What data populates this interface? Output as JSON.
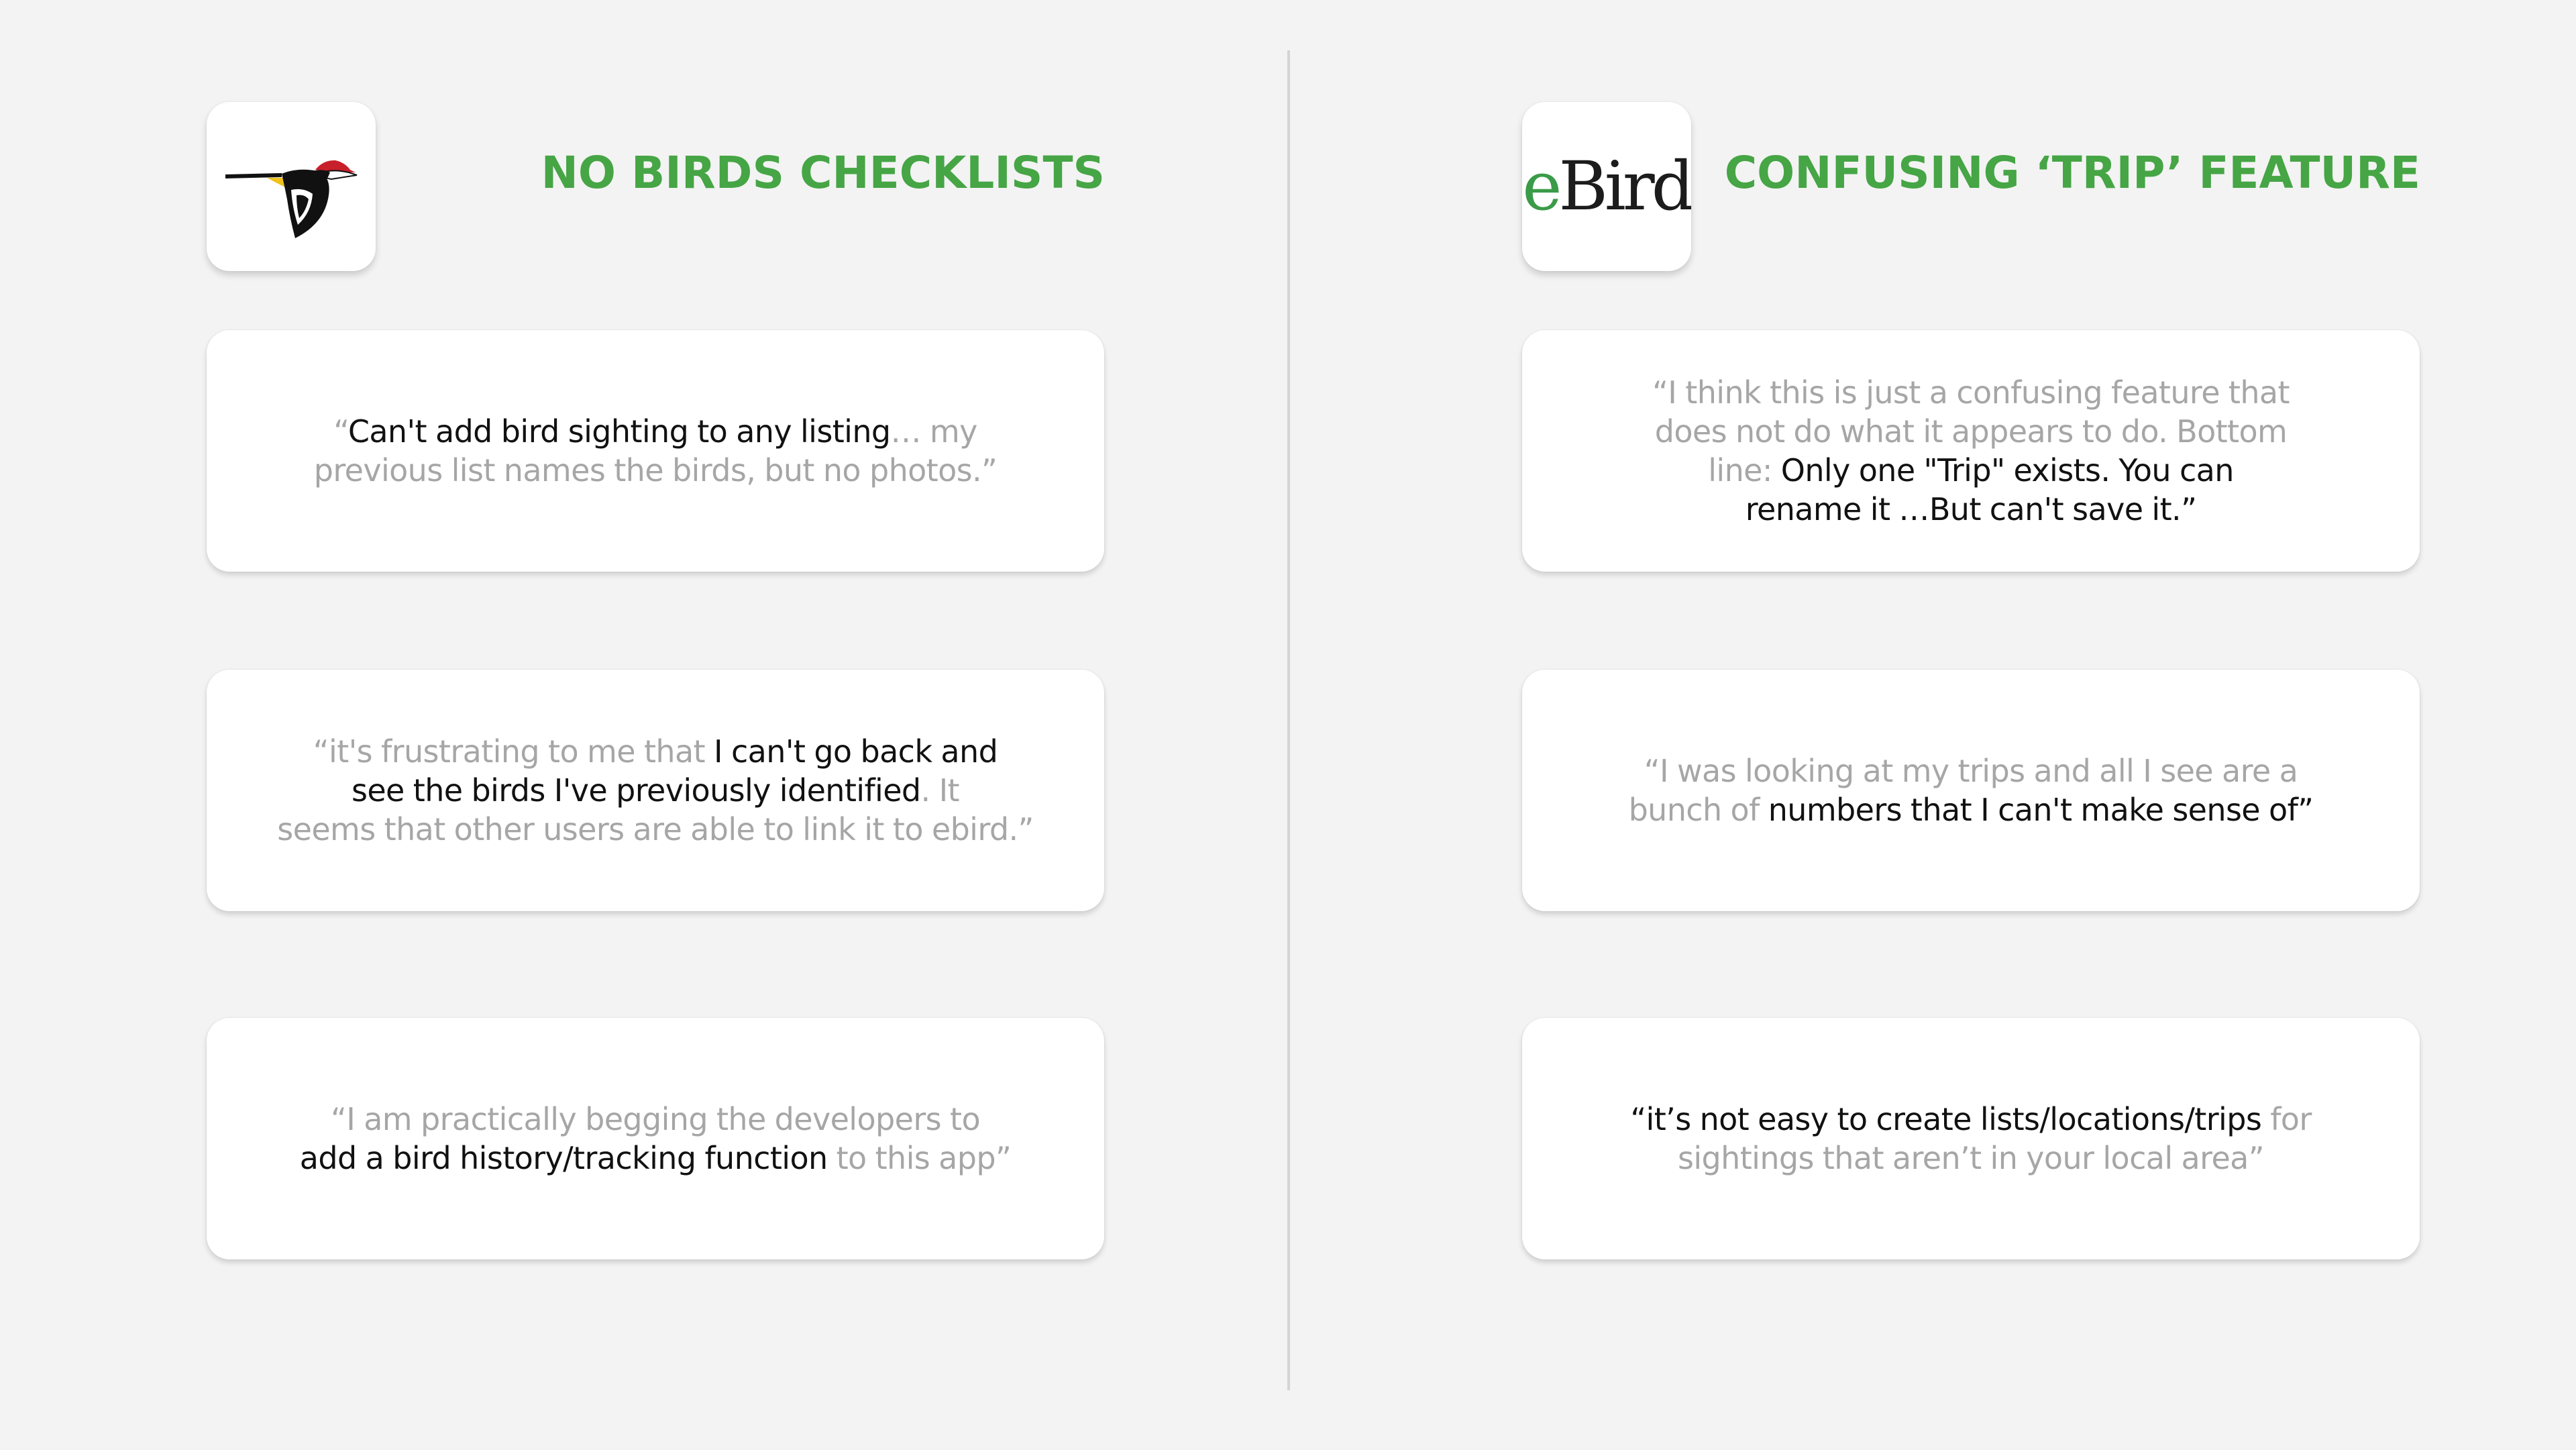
{
  "left": {
    "title": "NO BIRDS CHECKLISTS",
    "icon": "merlin-bird-id-icon",
    "quotes": [
      {
        "parts": [
          {
            "text": "“",
            "highlight": false
          },
          {
            "text": "Can't add bird sighting to any listing",
            "highlight": true
          },
          {
            "text": "… my ",
            "highlight": false
          },
          {
            "text": "\n",
            "highlight": false
          },
          {
            "text": "previous list names the birds, but no photos.”",
            "highlight": false
          }
        ]
      },
      {
        "parts": [
          {
            "text": "“it's frustrating to me that ",
            "highlight": false
          },
          {
            "text": "I can't go back and",
            "highlight": true
          },
          {
            "text": "\n",
            "highlight": false
          },
          {
            "text": "see the birds I've previously identified",
            "highlight": true
          },
          {
            "text": ". It",
            "highlight": false
          },
          {
            "text": "\n",
            "highlight": false
          },
          {
            "text": "seems that other users are able to link it to ebird.”",
            "highlight": false
          }
        ]
      },
      {
        "parts": [
          {
            "text": "“I am practically begging the developers to",
            "highlight": false
          },
          {
            "text": "\n",
            "highlight": false
          },
          {
            "text": "add a bird history/tracking function",
            "highlight": true
          },
          {
            "text": " to this app”",
            "highlight": false
          }
        ]
      }
    ]
  },
  "right": {
    "title": "CONFUSING ‘TRIP’ FEATURE",
    "icon": "ebird-icon",
    "logo_text_e": "e",
    "logo_text_rest": "Bird",
    "quotes": [
      {
        "parts": [
          {
            "text": "“I think this is just a confusing feature that",
            "highlight": false
          },
          {
            "text": "\n",
            "highlight": false
          },
          {
            "text": "does not do what it appears to do. Bottom",
            "highlight": false
          },
          {
            "text": "\n",
            "highlight": false
          },
          {
            "text": "line: ",
            "highlight": false
          },
          {
            "text": "Only one \"Trip\" exists. You can",
            "highlight": true
          },
          {
            "text": "\n",
            "highlight": false
          },
          {
            "text": "rename it …But can't save it.”",
            "highlight": true
          }
        ]
      },
      {
        "parts": [
          {
            "text": "“I was looking at my trips and all I see are a",
            "highlight": false
          },
          {
            "text": "\n",
            "highlight": false
          },
          {
            "text": "bunch of ",
            "highlight": false
          },
          {
            "text": "numbers that I can't make sense of”",
            "highlight": true
          }
        ]
      },
      {
        "parts": [
          {
            "text": "“it’s not easy to create lists/locations/trips",
            "highlight": true
          },
          {
            "text": " for",
            "highlight": false
          },
          {
            "text": "\n",
            "highlight": false
          },
          {
            "text": "sightings that aren’t in your local area”",
            "highlight": false
          }
        ]
      }
    ]
  },
  "colors": {
    "title": "#46a545",
    "highlight_text": "#111111",
    "muted_text": "#a6a6a6",
    "background": "#f3f3f3",
    "card": "#ffffff",
    "divider": "#d4d4d4",
    "ebird_e": "#3a9b48"
  }
}
